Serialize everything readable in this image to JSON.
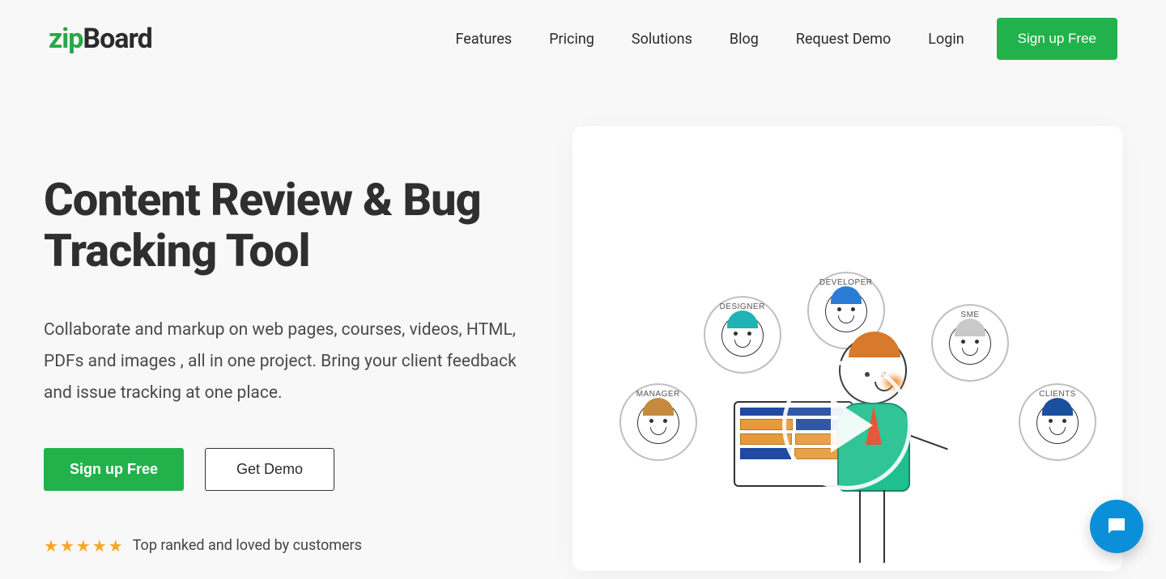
{
  "brand": {
    "part1": "zip",
    "part2": "Board"
  },
  "nav": {
    "items": [
      "Features",
      "Pricing",
      "Solutions",
      "Blog",
      "Request Demo",
      "Login"
    ],
    "cta": "Sign up Free"
  },
  "hero": {
    "title": "Content Review & Bug Tracking Tool",
    "description": "Collaborate and markup on web pages, courses, videos, HTML, PDFs and images , all in one project. Bring your client feedback and issue tracking at one place.",
    "primary_cta": "Sign up Free",
    "secondary_cta": "Get Demo",
    "rating_text": "Top ranked and loved by customers",
    "stars": 5
  },
  "illustration": {
    "roles": {
      "manager": "MANAGER",
      "designer": "DESIGNER",
      "developer": "DEVELOPER",
      "sme": "SME",
      "clients": "CLIENTS"
    }
  },
  "colors": {
    "accent": "#22b24c",
    "star": "#f5a623",
    "chat": "#0a8fd8"
  }
}
